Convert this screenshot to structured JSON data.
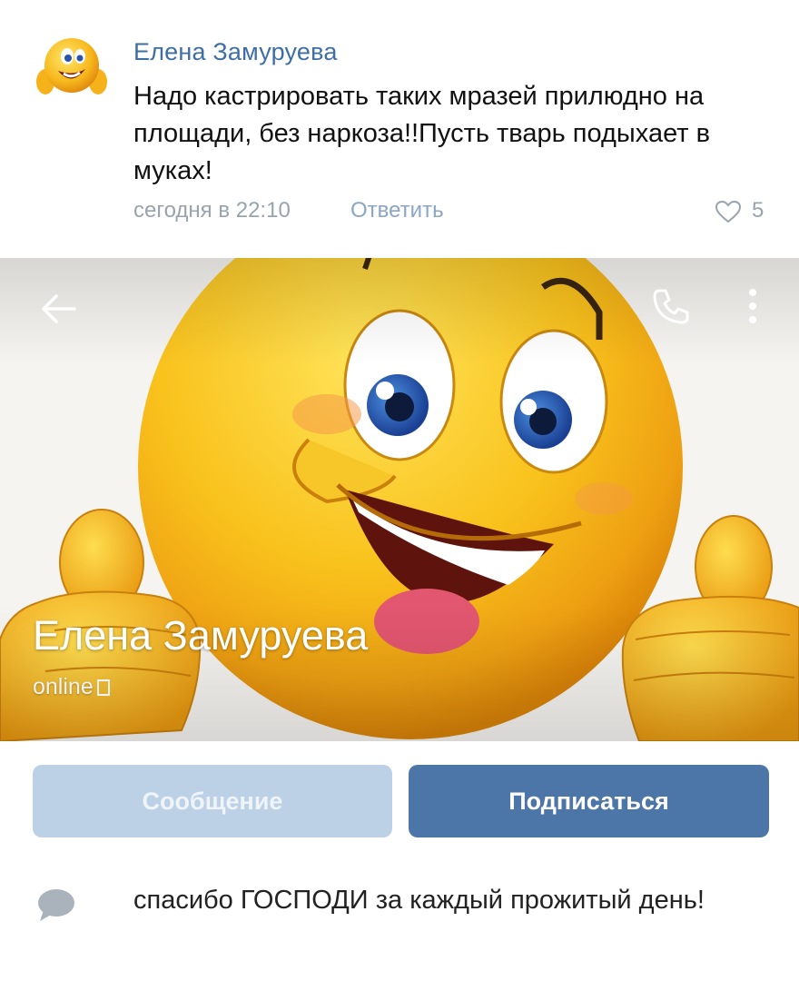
{
  "comment": {
    "author": "Елена Замуруева",
    "text": "Надо кастрировать таких мразей прилюдно на площади, без наркоза!!Пусть тварь подыхает в муках!",
    "timestamp": "сегодня в 22:10",
    "reply_label": "Ответить",
    "like_count": "5",
    "avatar_icon": "smiley-thumbs-up-icon"
  },
  "profile": {
    "name": "Елена Замуруева",
    "status": "online",
    "cover_icon": "smiley-thumbs-up-icon",
    "back_icon": "arrow-left-icon",
    "call_icon": "phone-icon",
    "more_icon": "more-vertical-icon"
  },
  "actions": {
    "message_label": "Сообщение",
    "subscribe_label": "Подписаться"
  },
  "status_line": {
    "text": "спасибо ГОСПОДИ за каждый прожитый день!",
    "icon": "speech-bubble-icon"
  },
  "colors": {
    "link_blue": "#3f6ea6",
    "button_primary": "#4d76a8",
    "button_disabled": "#bcd0e6",
    "meta_gray": "#9aa3ad"
  }
}
